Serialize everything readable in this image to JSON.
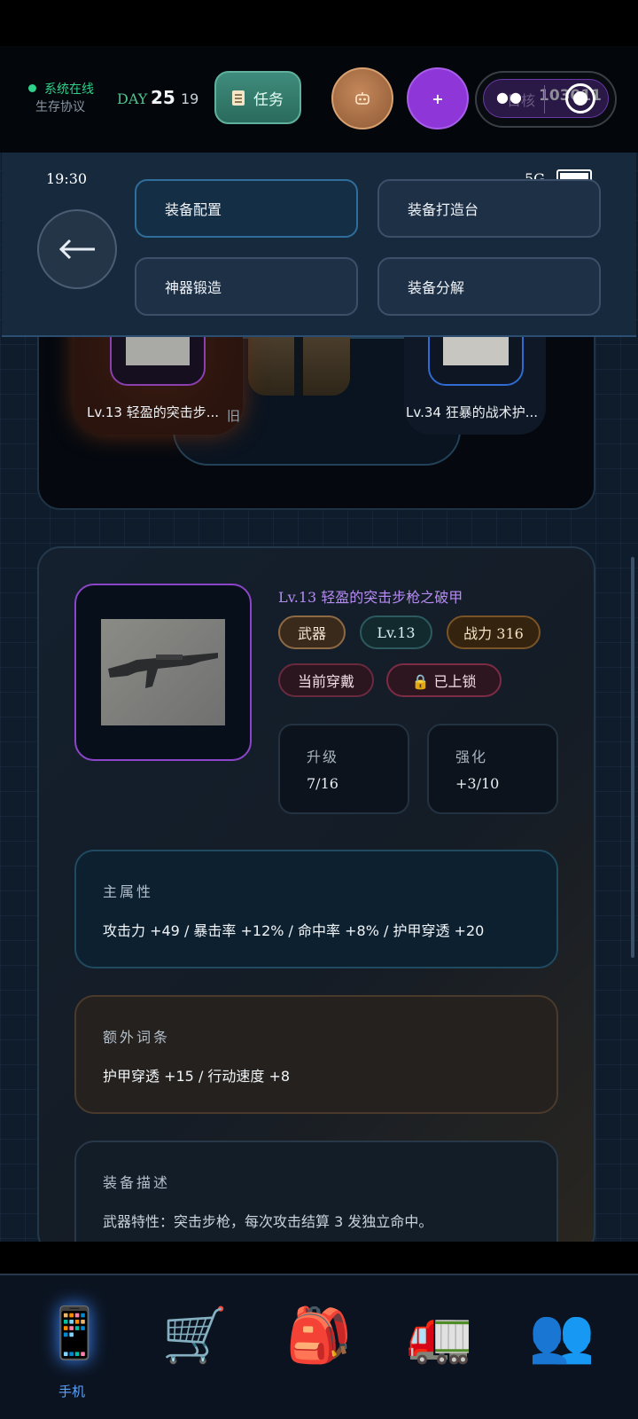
{
  "hud": {
    "system_status": "系统在线",
    "protocol": "生存协议",
    "day_label": "DAY",
    "day_number": "25",
    "hour": "19",
    "task_label": "任务",
    "robot_icon": "robot-icon",
    "plus_label": "+",
    "toggle_dots": "●●",
    "toggle_faded": "日核",
    "toggle_number": "103011"
  },
  "status_bar": {
    "time": "19:30",
    "network": "5G"
  },
  "menu": {
    "items": [
      {
        "label": "装备配置",
        "active": true
      },
      {
        "label": "装备打造台",
        "active": false
      },
      {
        "label": "神器锻造",
        "active": false
      },
      {
        "label": "装备分解",
        "active": false
      }
    ]
  },
  "slots": {
    "left_label": "Lv.13 轻盈的突击步...",
    "middle_label": "旧",
    "right_label": "Lv.34 狂暴的战术护..."
  },
  "item": {
    "title": "Lv.13 轻盈的突击步枪之破甲",
    "tags": [
      "武器",
      "Lv.13",
      "战力 316"
    ],
    "tags2": [
      "当前穿戴",
      "🔒 已上锁"
    ],
    "upgrade_label": "升级",
    "upgrade_value": "7/16",
    "enhance_label": "强化",
    "enhance_value": "+3/10",
    "main_attr_title": "主属性",
    "main_attr": "攻击力 +49 / 暴击率 +12% / 命中率 +8% / 护甲穿透 +20",
    "extra_attr_title": "额外词条",
    "extra_attr": "护甲穿透 +15 / 行动速度 +8",
    "desc_title": "装备描述",
    "desc": "武器特性：突击步枪，每次攻击结算 3 发独立命中。"
  },
  "nav": {
    "phone_label": "手机",
    "icons": [
      "phone-icon",
      "cart-icon",
      "backpack-icon",
      "truck-icon",
      "people-icon"
    ],
    "glyphs": [
      "📱",
      "🛒",
      "🎒",
      "🚛",
      "👥"
    ]
  },
  "colors": {
    "accent_purple": "#8e36d8",
    "accent_green": "#2fd08a",
    "nav_blue": "#5ba3ff"
  }
}
